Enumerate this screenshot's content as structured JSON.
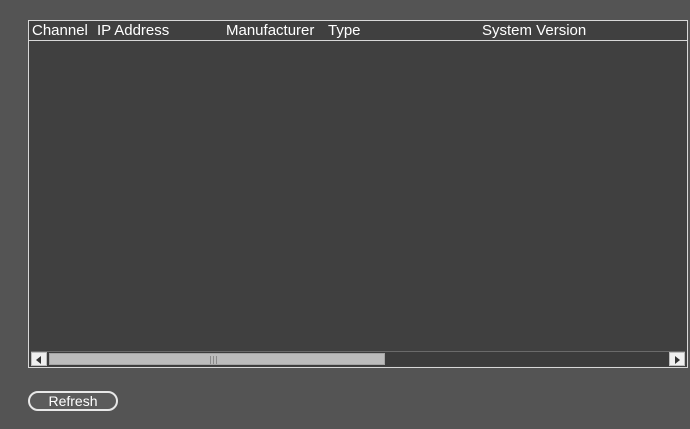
{
  "table": {
    "columns": {
      "channel": "Channel",
      "ip_address": "IP Address",
      "manufacturer": "Manufacturer",
      "type": "Type",
      "system_version": "System Version"
    },
    "rows": []
  },
  "scrollbar": {
    "thumb_position": 0
  },
  "actions": {
    "refresh_label": "Refresh"
  },
  "colors": {
    "background": "#545454",
    "panel": "#404040",
    "border": "#d8d8d8",
    "text": "#ffffff"
  }
}
